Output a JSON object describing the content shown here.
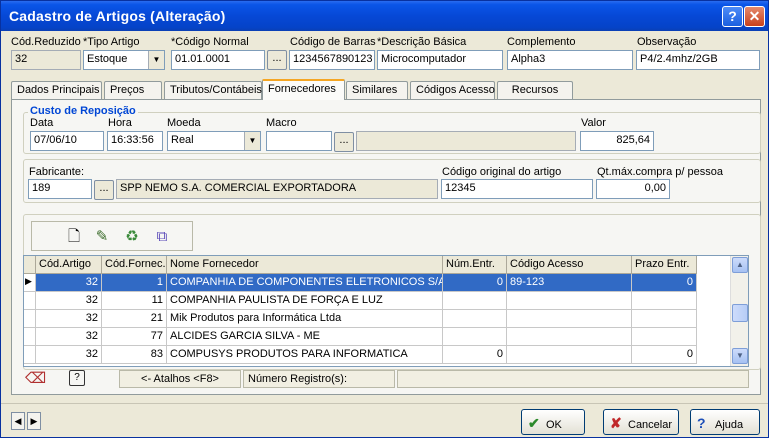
{
  "window": {
    "title": "Cadastro de Artigos (Alteração)",
    "help_btn": "?",
    "close_btn": "✕"
  },
  "header": {
    "cod_reduzido": {
      "label": "Cód.Reduzido",
      "value": "32"
    },
    "tipo_artigo": {
      "label": "*Tipo Artigo",
      "value": "Estoque"
    },
    "codigo_normal": {
      "label": "*Código Normal",
      "value": "01.01.0001"
    },
    "codigo_barras": {
      "label": "Código de Barras",
      "value": "1234567890123"
    },
    "descricao_basica": {
      "label": "*Descrição Básica",
      "value": "Microcomputador"
    },
    "complemento": {
      "label": "Complemento",
      "value": "Alpha3"
    },
    "observacao": {
      "label": "Observação",
      "value": "P4/2.4mhz/2GB"
    },
    "ellipsis": "..."
  },
  "tabs": [
    {
      "label": "Dados Principais"
    },
    {
      "label": "Preços"
    },
    {
      "label": "Tributos/Contábeis"
    },
    {
      "label": "Fornecedores"
    },
    {
      "label": "Similares"
    },
    {
      "label": "Códigos Acesso"
    },
    {
      "label": "Recursos"
    }
  ],
  "custo": {
    "group_title": "Custo de Reposição",
    "data": {
      "label": "Data",
      "value": "07/06/10"
    },
    "hora": {
      "label": "Hora",
      "value": "16:33:56"
    },
    "moeda": {
      "label": "Moeda",
      "value": "Real"
    },
    "macro": {
      "label": "Macro",
      "value": ""
    },
    "valor": {
      "label": "Valor",
      "value": "825,64"
    }
  },
  "fabricante": {
    "label": "Fabricante:",
    "code": "189",
    "name": "SPP NEMO S.A. COMERCIAL EXPORTADORA",
    "codigo_original": {
      "label": "Código original do artigo",
      "value": "12345"
    },
    "qt_max": {
      "label": "Qt.máx.compra p/ pessoa",
      "value": "0,00"
    }
  },
  "toolbar": {
    "icons": [
      "new-document-icon",
      "edit-record-icon",
      "recycle-bin-icon",
      "copy-records-icon"
    ]
  },
  "grid": {
    "headers": [
      "Cód.Artigo",
      "Cód.Fornec.",
      "Nome Fornecedor",
      "Núm.Entr.",
      "Código Acesso",
      "Prazo Entr."
    ],
    "rows": [
      {
        "ind": "▶",
        "cod_artigo": "32",
        "cod_fornec": "1",
        "nome": "COMPANHIA DE COMPONENTES ELETRONICOS S/A",
        "num_entr": "0",
        "codigo_acesso": "89-123",
        "prazo": "0"
      },
      {
        "ind": "",
        "cod_artigo": "32",
        "cod_fornec": "11",
        "nome": "COMPANHIA PAULISTA DE FORÇA E LUZ",
        "num_entr": "",
        "codigo_acesso": "",
        "prazo": ""
      },
      {
        "ind": "",
        "cod_artigo": "32",
        "cod_fornec": "21",
        "nome": "Mik Produtos para Informática Ltda",
        "num_entr": "",
        "codigo_acesso": "",
        "prazo": ""
      },
      {
        "ind": "",
        "cod_artigo": "32",
        "cod_fornec": "77",
        "nome": "ALCIDES GARCIA SILVA - ME",
        "num_entr": "",
        "codigo_acesso": "",
        "prazo": ""
      },
      {
        "ind": "",
        "cod_artigo": "32",
        "cod_fornec": "83",
        "nome": "COMPUSYS PRODUTOS PARA INFORMATICA",
        "num_entr": "0",
        "codigo_acesso": "",
        "prazo": "0"
      }
    ]
  },
  "status": {
    "help_icon": "?",
    "atalhos": "<- Atalhos <F8>",
    "num_registro_label": "Número Registro(s):",
    "num_registro_value": ""
  },
  "buttons": {
    "nav_prev": "◀",
    "nav_next": "▶",
    "ok": "OK",
    "cancelar": "Cancelar",
    "ajuda": "Ajuda"
  },
  "colors": {
    "title_bar": "#0648d6",
    "selected_row": "#316ac5",
    "group_title": "#0046d5",
    "active_tab_accent": "#f5a623"
  }
}
